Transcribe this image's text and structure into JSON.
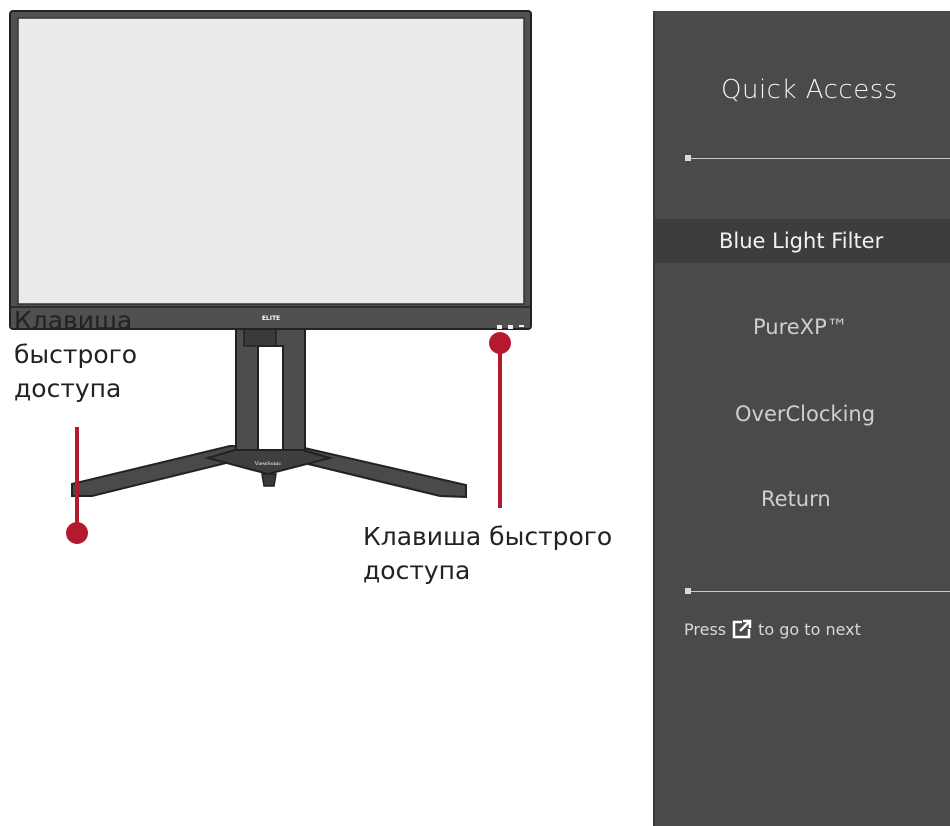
{
  "callouts": {
    "left": "Клавиша быстрого доступа",
    "right": "Клавиша быстрого доступа"
  },
  "monitor": {
    "series_logo": "ELITE",
    "brand_logo": "ViewSonic"
  },
  "osd": {
    "title": "Quick Access",
    "items": [
      {
        "label": "Blue Light Filter",
        "selected": true
      },
      {
        "label": "PureXP™",
        "selected": false
      },
      {
        "label": "OverClocking",
        "selected": false
      },
      {
        "label": "Return",
        "selected": false
      }
    ],
    "hint": {
      "before": "Press",
      "icon": "shortcut-arrow-icon",
      "after": "to go to next"
    }
  },
  "colors": {
    "callout_line": "#b5192e",
    "osd_background": "#4a4a4a",
    "osd_selected_row": "#3d3d3d",
    "monitor_screen": "#ebebeb",
    "monitor_body": "#4b4b4b"
  }
}
